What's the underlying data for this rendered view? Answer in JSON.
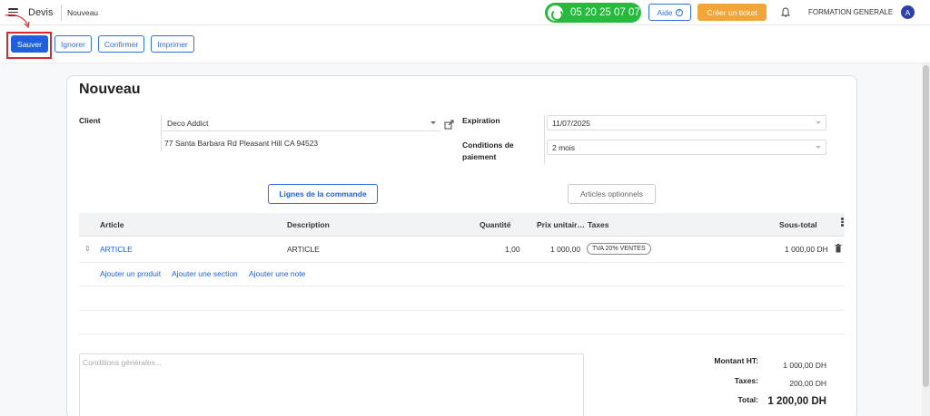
{
  "topbar": {
    "app_name": "Devis",
    "breadcrumb": "Nouveau",
    "phone": "05 20 25 07 07",
    "help_label": "Aide",
    "ticket_label": "Créer un ticket",
    "company": "FORMATION GENERALE",
    "avatar_letter": "A"
  },
  "actions": {
    "save": "Sauver",
    "ignore": "Ignorer",
    "confirm": "Confirmer",
    "print": "Imprimer"
  },
  "form": {
    "title": "Nouveau",
    "client_label": "Client",
    "client_value": "Deco Addict",
    "client_address": "77 Santa Barbara Rd Pleasant Hill CA 94523",
    "expiration_label": "Expiration",
    "expiration_value": "11/07/2025",
    "payment_label_line1": "Conditions de",
    "payment_label_line2": "paiement",
    "payment_value": "2 mois"
  },
  "tabs": {
    "order_lines": "Lignes de la commande",
    "optional": "Articles optionnels"
  },
  "table": {
    "headers": {
      "article": "Article",
      "description": "Description",
      "quantity": "Quantité",
      "unit_price": "Prix unitair…",
      "taxes": "Taxes",
      "subtotal": "Sous-total"
    },
    "rows": [
      {
        "article": "ARTICLE",
        "description": "ARTICLE",
        "quantity": "1,00",
        "unit_price": "1 000,00",
        "tax_badge": "TVA 20% VENTES",
        "subtotal": "1 000,00 DH"
      }
    ],
    "add_links": {
      "product": "Ajouter un produit",
      "section": "Ajouter une section",
      "note": "Ajouter une note"
    }
  },
  "notes": {
    "placeholder": "Conditions générales..."
  },
  "totals": {
    "ht_label": "Montant HT:",
    "ht_value": "1 000,00 DH",
    "tax_label": "Taxes:",
    "tax_value": "200,00 DH",
    "total_label": "Total:",
    "total_value": "1 200,00 DH"
  },
  "colors": {
    "primary": "#1f5fe0",
    "phone_green": "#28b93f",
    "ticket_orange": "#f2a63a",
    "highlight_red": "#e0262b"
  }
}
